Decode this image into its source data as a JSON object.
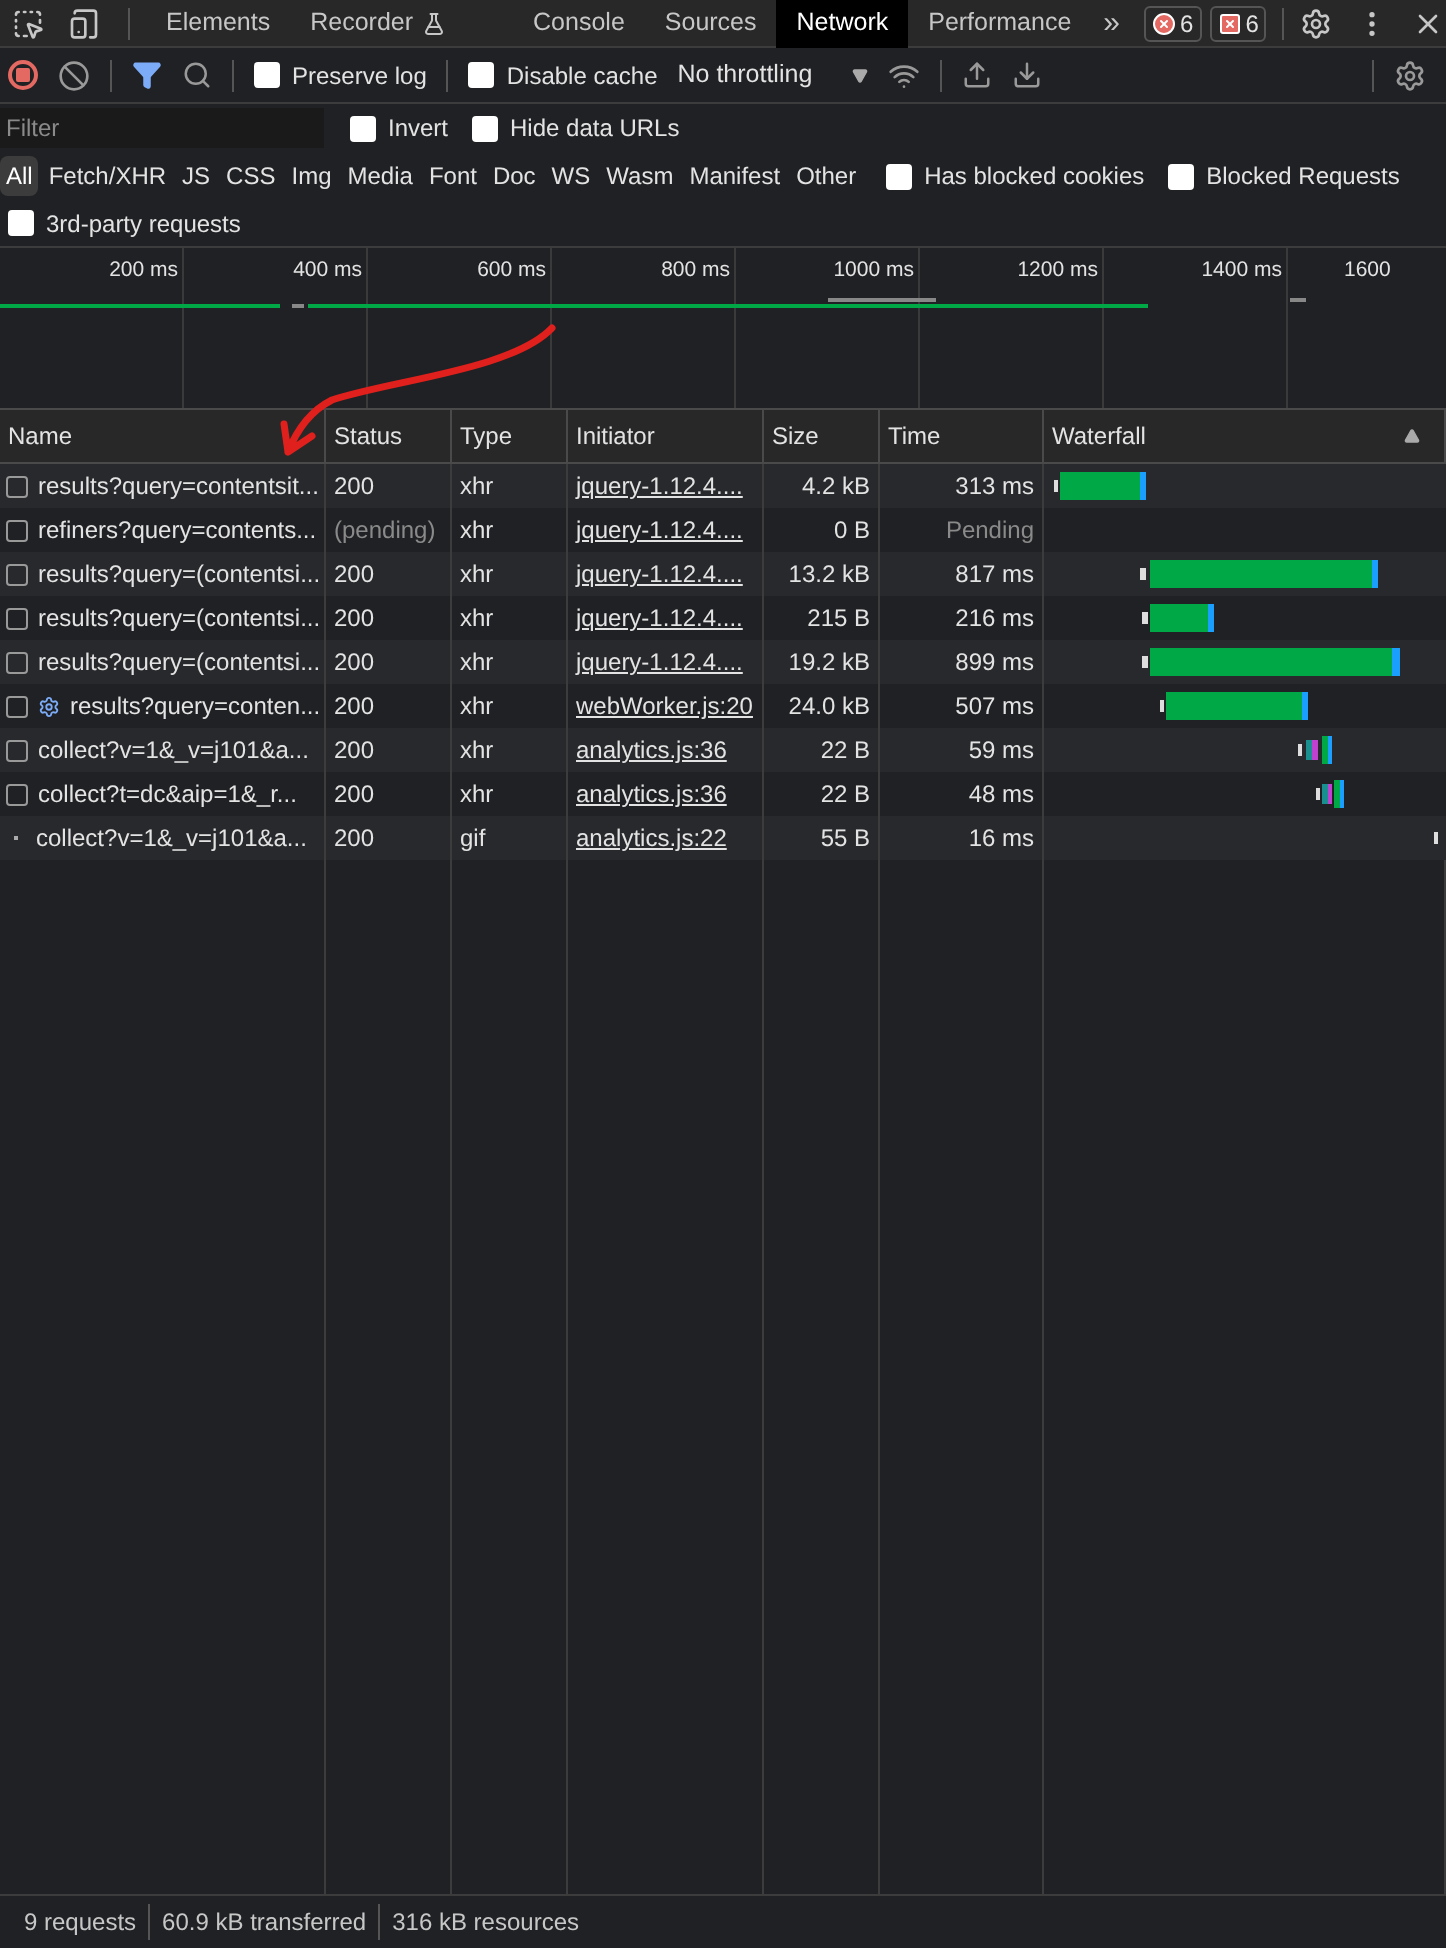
{
  "tabs": [
    {
      "label": "Elements",
      "selected": false,
      "kind": "plain"
    },
    {
      "label": "Recorder",
      "selected": false,
      "kind": "flask"
    },
    {
      "label": "Console",
      "selected": false,
      "kind": "plain"
    },
    {
      "label": "Sources",
      "selected": false,
      "kind": "plain"
    },
    {
      "label": "Network",
      "selected": true,
      "kind": "plain"
    },
    {
      "label": "Performance",
      "selected": false,
      "kind": "plain"
    }
  ],
  "more_tabs": "»",
  "badges": [
    {
      "kind": "error",
      "count": "6"
    },
    {
      "kind": "issue",
      "count": "6"
    }
  ],
  "toolbar": {
    "recording": true,
    "filter_active": true,
    "preserve_log": {
      "label": "Preserve log",
      "checked": false
    },
    "disable_cache": {
      "label": "Disable cache",
      "checked": false
    },
    "throttling": "No throttling"
  },
  "filter": {
    "placeholder": "Filter",
    "invert": {
      "label": "Invert",
      "checked": false
    },
    "hide_data_urls": {
      "label": "Hide data URLs",
      "checked": false
    }
  },
  "type_filters": [
    {
      "label": "All",
      "selected": true
    },
    {
      "label": "Fetch/XHR",
      "selected": false
    },
    {
      "label": "JS",
      "selected": false
    },
    {
      "label": "CSS",
      "selected": false
    },
    {
      "label": "Img",
      "selected": false
    },
    {
      "label": "Media",
      "selected": false
    },
    {
      "label": "Font",
      "selected": false
    },
    {
      "label": "Doc",
      "selected": false
    },
    {
      "label": "WS",
      "selected": false
    },
    {
      "label": "Wasm",
      "selected": false
    },
    {
      "label": "Manifest",
      "selected": false
    },
    {
      "label": "Other",
      "selected": false
    }
  ],
  "has_blocked_cookies": {
    "label": "Has blocked cookies",
    "checked": false
  },
  "blocked_requests": {
    "label": "Blocked Requests",
    "checked": false
  },
  "third_party": {
    "label": "3rd-party requests",
    "checked": false
  },
  "overview_ticks": [
    "200 ms",
    "400 ms",
    "600 ms",
    "800 ms",
    "1000 ms",
    "1200 ms",
    "1400 ms",
    "1600"
  ],
  "table": {
    "columns": [
      "Name",
      "Status",
      "Type",
      "Initiator",
      "Size",
      "Time",
      "Waterfall"
    ],
    "rows": [
      {
        "kind": "checkbox",
        "worker": false,
        "name": "results?query=contentsit...",
        "status": "200",
        "pending": false,
        "type": "xhr",
        "initiator": "jquery-1.12.4....",
        "size": "4.2 kB",
        "time": "313 ms"
      },
      {
        "kind": "checkbox",
        "worker": false,
        "name": "refiners?query=contents...",
        "status": "(pending)",
        "pending": true,
        "type": "xhr",
        "initiator": "jquery-1.12.4....",
        "size": "0 B",
        "time": "Pending"
      },
      {
        "kind": "checkbox",
        "worker": false,
        "name": "results?query=(contentsi...",
        "status": "200",
        "pending": false,
        "type": "xhr",
        "initiator": "jquery-1.12.4....",
        "size": "13.2 kB",
        "time": "817 ms"
      },
      {
        "kind": "checkbox",
        "worker": false,
        "name": "results?query=(contentsi...",
        "status": "200",
        "pending": false,
        "type": "xhr",
        "initiator": "jquery-1.12.4....",
        "size": "215 B",
        "time": "216 ms"
      },
      {
        "kind": "checkbox",
        "worker": false,
        "name": "results?query=(contentsi...",
        "status": "200",
        "pending": false,
        "type": "xhr",
        "initiator": "jquery-1.12.4....",
        "size": "19.2 kB",
        "time": "899 ms"
      },
      {
        "kind": "checkbox",
        "worker": true,
        "name": "results?query=conten...",
        "status": "200",
        "pending": false,
        "type": "xhr",
        "initiator": "webWorker.js:20",
        "size": "24.0 kB",
        "time": "507 ms"
      },
      {
        "kind": "checkbox",
        "worker": false,
        "name": "collect?v=1&_v=j101&a...",
        "status": "200",
        "pending": false,
        "type": "xhr",
        "initiator": "analytics.js:36",
        "size": "22 B",
        "time": "59 ms"
      },
      {
        "kind": "checkbox",
        "worker": false,
        "name": "collect?t=dc&aip=1&_r...",
        "status": "200",
        "pending": false,
        "type": "xhr",
        "initiator": "analytics.js:36",
        "size": "22 B",
        "time": "48 ms"
      },
      {
        "kind": "dot",
        "worker": false,
        "name": "collect?v=1&_v=j101&a...",
        "status": "200",
        "pending": false,
        "type": "gif",
        "initiator": "analytics.js:22",
        "size": "55 B",
        "time": "16 ms"
      }
    ]
  },
  "status_bar": [
    "9 requests",
    "60.9 kB transferred",
    "316 kB resources"
  ]
}
